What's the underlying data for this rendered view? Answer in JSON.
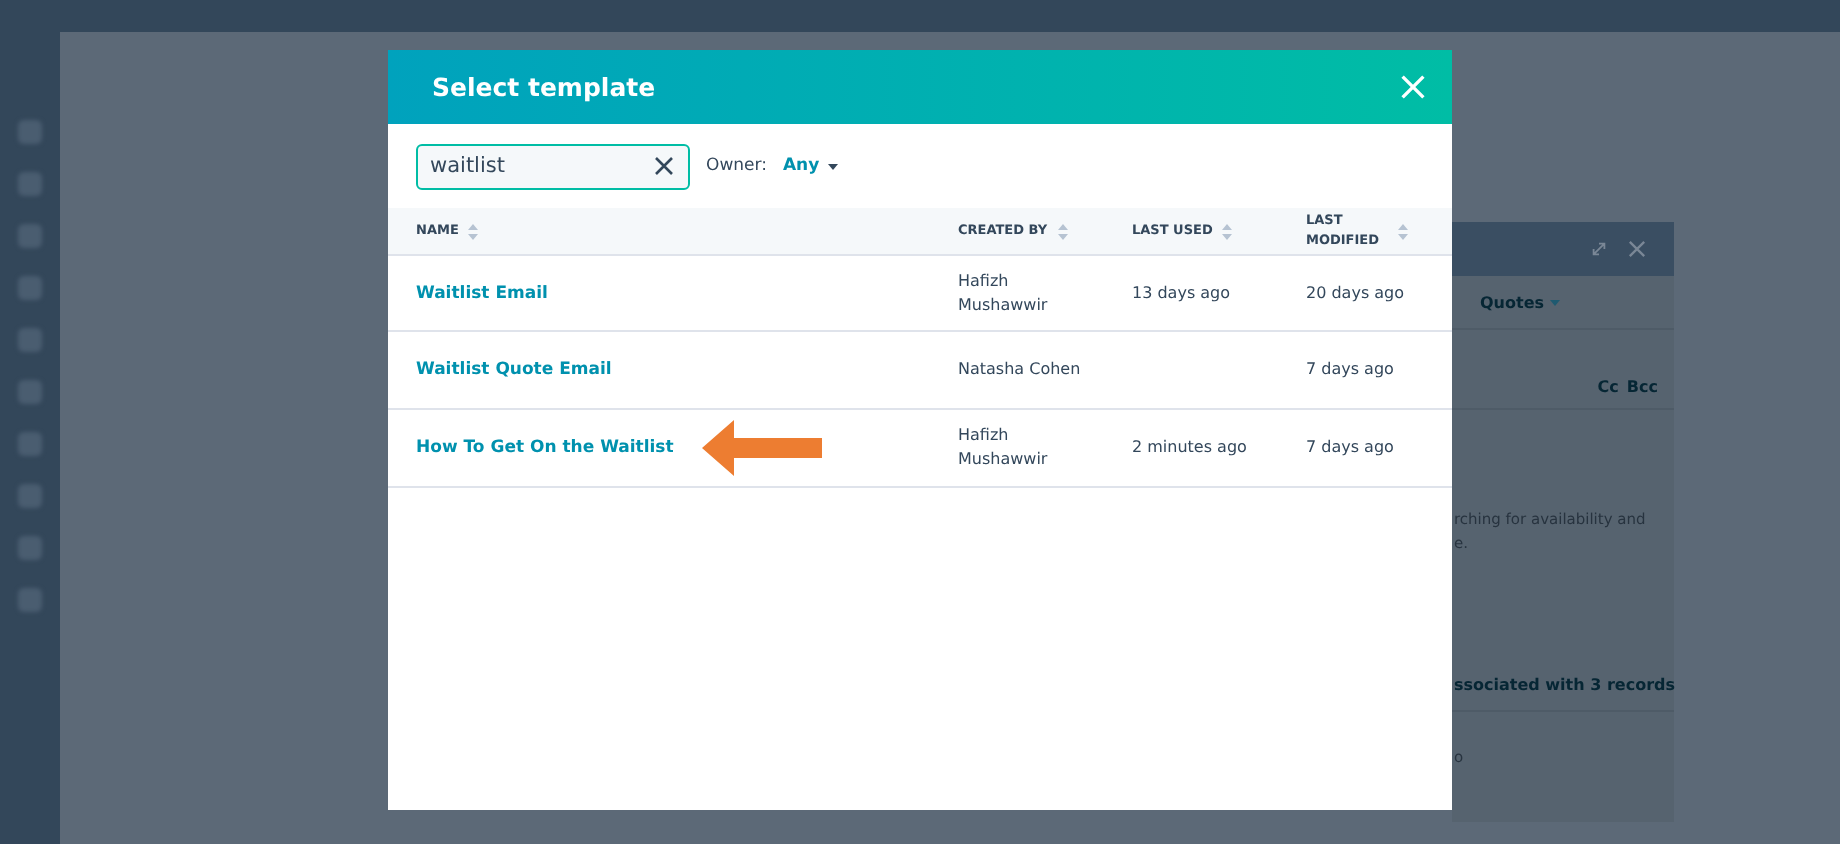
{
  "modal": {
    "title": "Select template",
    "search": {
      "value": "waitlist"
    },
    "owner_filter": {
      "label": "Owner:",
      "value": "Any"
    },
    "table": {
      "columns": [
        "NAME",
        "CREATED BY",
        "LAST USED",
        "LAST MODIFIED"
      ],
      "rows": [
        {
          "name": "Waitlist Email",
          "created_by": "Hafizh Mushawwir",
          "last_used": "13 days ago",
          "last_modified": "20 days ago",
          "highlighted": false
        },
        {
          "name": "Waitlist Quote Email",
          "created_by": "Natasha Cohen",
          "last_used": "",
          "last_modified": "7 days ago",
          "highlighted": false
        },
        {
          "name": "How To Get On the Waitlist",
          "created_by": "Hafizh Mushawwir",
          "last_used": "2 minutes ago",
          "last_modified": "7 days ago",
          "highlighted": true
        }
      ]
    }
  },
  "composer": {
    "tab": "Quotes",
    "cc": "Cc",
    "bcc": "Bcc",
    "body_lines": [
      "rching for availability and",
      "e."
    ],
    "association": "ssociated with 3 records",
    "footer_text": "o"
  }
}
